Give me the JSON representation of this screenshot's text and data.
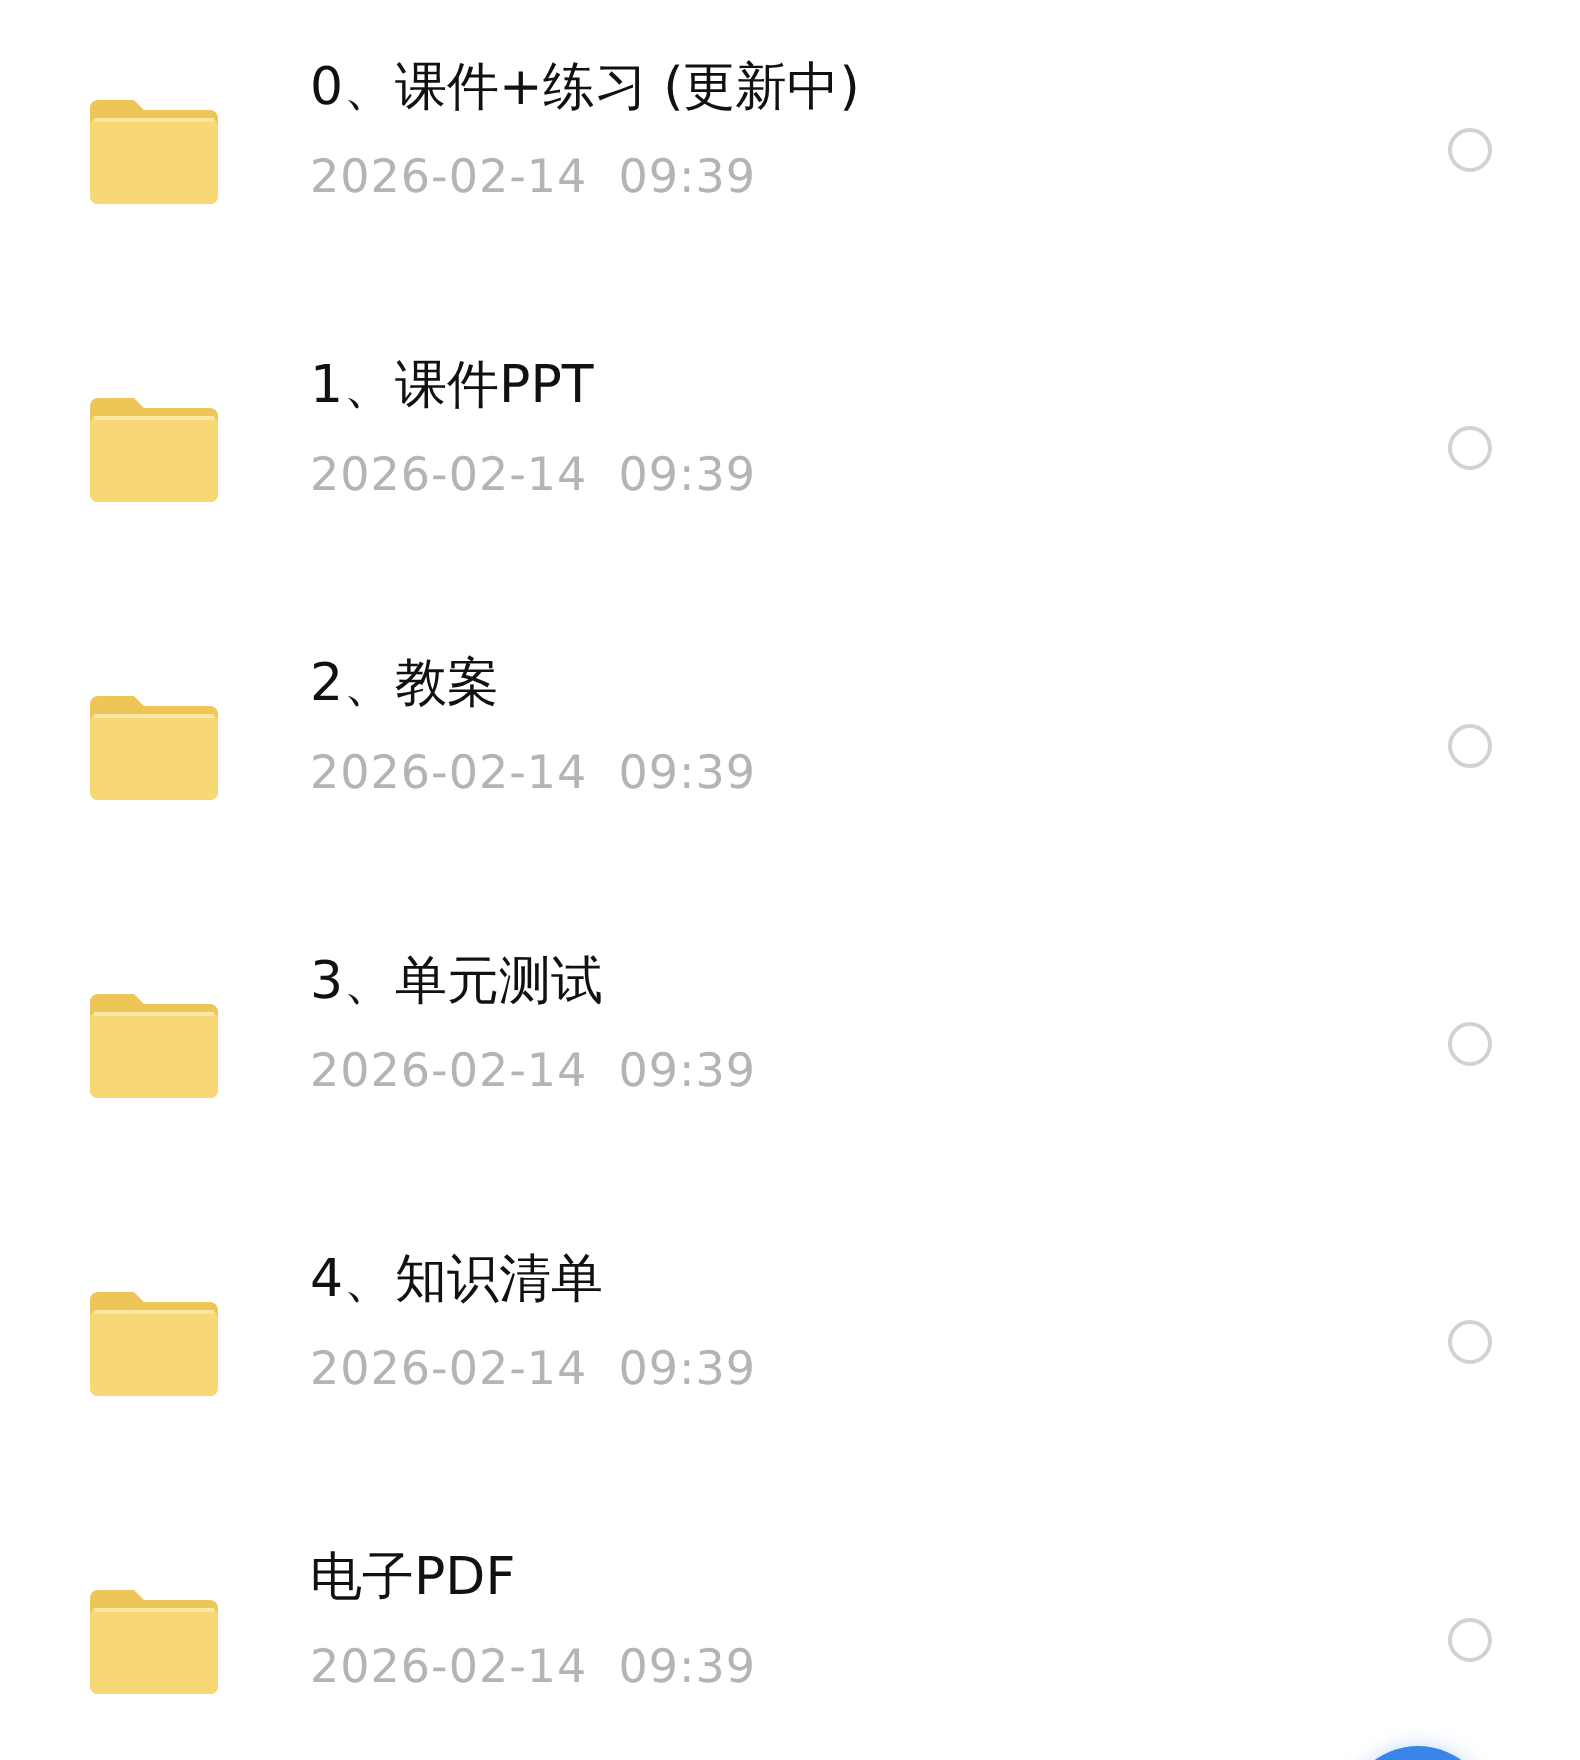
{
  "files": [
    {
      "name": "0、课件+练习 (更新中)",
      "modified": "2026-02-14  09:39",
      "selected": false
    },
    {
      "name": "1、课件PPT",
      "modified": "2026-02-14  09:39",
      "selected": false
    },
    {
      "name": "2、教案",
      "modified": "2026-02-14  09:39",
      "selected": false
    },
    {
      "name": "3、单元测试",
      "modified": "2026-02-14  09:39",
      "selected": false
    },
    {
      "name": "4、知识清单",
      "modified": "2026-02-14  09:39",
      "selected": false
    },
    {
      "name": "电子PDF",
      "modified": "2026-02-14  09:39",
      "selected": false
    }
  ]
}
